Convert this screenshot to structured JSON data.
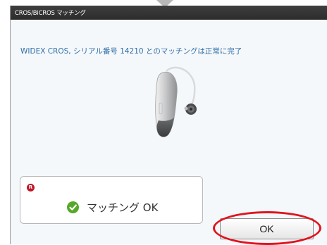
{
  "dialog": {
    "title": "CROS/BiCROS マッチング",
    "message": "WIDEX CROS, シリアル番号 14210 とのマッチングは正常に完了",
    "device_image": "hearing-aid-image",
    "status": {
      "badge": "R",
      "icon": "check-circle-icon",
      "text": "マッチング OK"
    },
    "ok_label": "OK"
  },
  "colors": {
    "titlebar": "#2f2f2f",
    "message_text": "#2f6ea7",
    "check_green": "#55a829",
    "badge_red": "#c0152a",
    "highlight_red": "#e0141e"
  }
}
